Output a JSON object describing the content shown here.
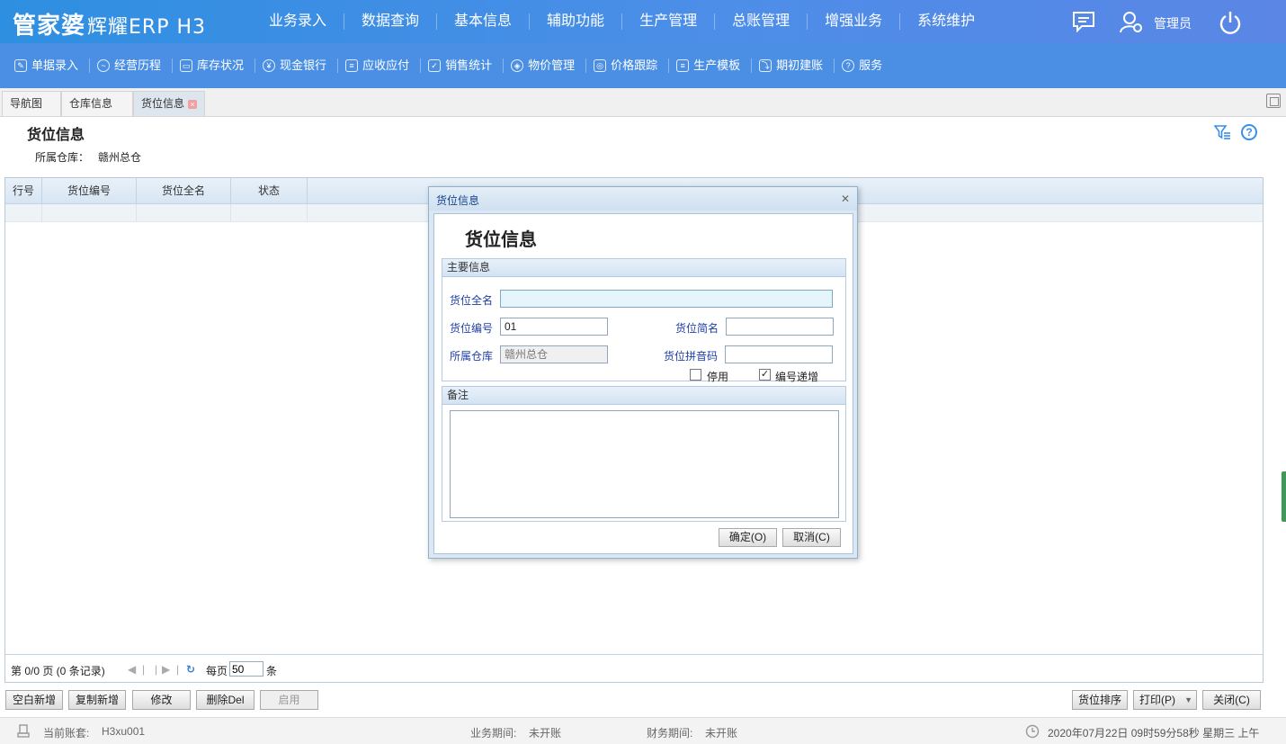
{
  "app": {
    "logo_main": "管家婆",
    "logo_sub": "辉耀ERP H3",
    "nav": [
      "业务录入",
      "数据查询",
      "基本信息",
      "辅助功能",
      "生产管理",
      "总账管理",
      "增强业务",
      "系统维护"
    ],
    "user": "管理员"
  },
  "toolbar": [
    {
      "label": "单据录入",
      "icon": "edit-icon"
    },
    {
      "label": "经营历程",
      "icon": "history-icon"
    },
    {
      "label": "库存状况",
      "icon": "inventory-icon"
    },
    {
      "label": "现金银行",
      "icon": "money-icon"
    },
    {
      "label": "应收应付",
      "icon": "receivable-icon"
    },
    {
      "label": "销售统计",
      "icon": "sales-stats-icon"
    },
    {
      "label": "物价管理",
      "icon": "price-manage-icon"
    },
    {
      "label": "价格跟踪",
      "icon": "price-track-icon"
    },
    {
      "label": "生产模板",
      "icon": "template-icon"
    },
    {
      "label": "期初建账",
      "icon": "opening-account-icon"
    },
    {
      "label": "服务",
      "icon": "help-icon"
    }
  ],
  "tabs": [
    {
      "label": "导航图"
    },
    {
      "label": "仓库信息"
    },
    {
      "label": "货位信息"
    }
  ],
  "page": {
    "title": "货位信息",
    "warehouse_label": "所属仓库：",
    "warehouse_value": "赣州总仓"
  },
  "grid": {
    "columns": [
      "行号",
      "货位编号",
      "货位全名",
      "状态"
    ],
    "pager": {
      "summary": "第 0/0 页 (0 条记录)",
      "per_page_label": "每页",
      "per_page_value": "50",
      "unit": "条"
    }
  },
  "actions_left": [
    "空白新增",
    "复制新增",
    "修改",
    "删除Del",
    "启用"
  ],
  "actions_right": [
    "货位排序",
    "打印(P)",
    "关闭(C)"
  ],
  "status": {
    "account_label": "当前账套:",
    "account_value": "H3xu001",
    "biz_period_label": "业务期间:",
    "biz_period_value": "未开账",
    "fin_period_label": "财务期间:",
    "fin_period_value": "未开账",
    "datetime": "2020年07月22日 09时59分58秒 星期三 上午"
  },
  "dialog": {
    "window_title": "货位信息",
    "heading": "货位信息",
    "main_section": "主要信息",
    "full_name_label": "货位全名",
    "full_name_value": "",
    "code_label": "货位编号",
    "code_value": "01",
    "short_name_label": "货位简名",
    "short_name_value": "",
    "warehouse_label": "所属仓库",
    "warehouse_value": "赣州总仓",
    "pinyin_label": "货位拼音码",
    "pinyin_value": "",
    "disable_label": "停用",
    "disable_checked": false,
    "auto_inc_label": "编号递增",
    "auto_inc_checked": true,
    "notes_section": "备注",
    "ok_label": "确定(O)",
    "cancel_label": "取消(C)"
  }
}
